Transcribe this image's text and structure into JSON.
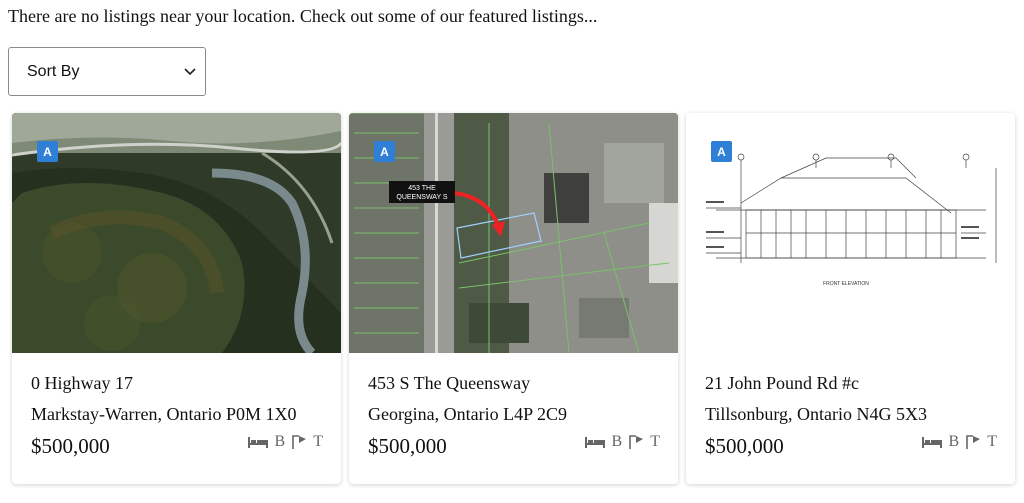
{
  "notice": "There are no listings near your location. Check out some of our featured listings...",
  "sort": {
    "label": "Sort By",
    "icon": "chevron-down-icon"
  },
  "listings": [
    {
      "badge": "A",
      "address": "0 Highway 17",
      "city": "Markstay-Warren, Ontario P0M 1X0",
      "price": "$500,000",
      "photo": "aerial-forest-photo",
      "feature_icons": [
        "bed-icon",
        "bath-icon",
        "tape-icon"
      ],
      "feature_labels": [
        "B",
        "T"
      ]
    },
    {
      "badge": "A",
      "address": "453 S The Queensway",
      "city": "Georgina, Ontario L4P 2C9",
      "price": "$500,000",
      "photo": "aerial-map-photo",
      "map_label": [
        "453 THE",
        "QUEENSWAY S"
      ],
      "feature_icons": [
        "bed-icon",
        "bath-icon",
        "tape-icon"
      ],
      "feature_labels": [
        "B",
        "T"
      ]
    },
    {
      "badge": "A",
      "address": "21 John Pound Rd #c",
      "city": "Tillsonburg, Ontario N4G 5X3",
      "price": "$500,000",
      "photo": "elevation-drawing",
      "drawing_caption": "FRONT ELEVATION",
      "feature_icons": [
        "bed-icon",
        "bath-icon",
        "tape-icon"
      ],
      "feature_labels": [
        "B",
        "T"
      ]
    }
  ],
  "colors": {
    "badge": "#2f7fd6",
    "icon": "#666666"
  }
}
